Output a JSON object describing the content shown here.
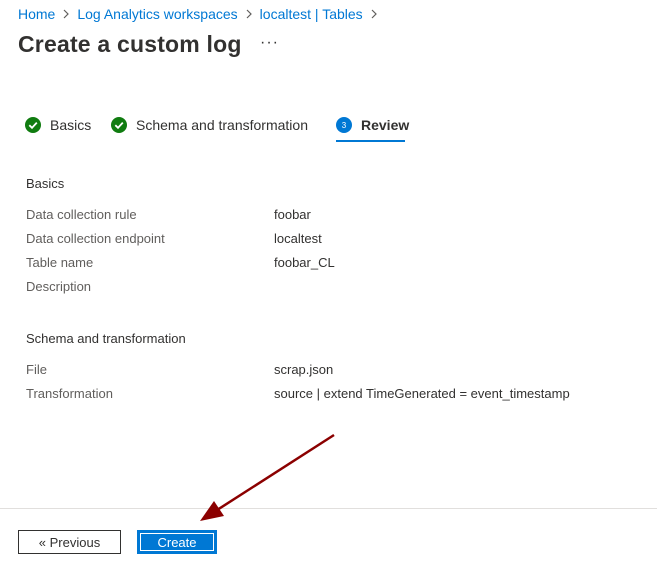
{
  "breadcrumb": {
    "items": [
      "Home",
      "Log Analytics workspaces",
      "localtest | Tables"
    ]
  },
  "page": {
    "title": "Create a custom log",
    "more_label": "···"
  },
  "steps": [
    {
      "label": "Basics",
      "status": "complete"
    },
    {
      "label": "Schema and transformation",
      "status": "complete"
    },
    {
      "label": "Review",
      "status": "active",
      "number": "3"
    }
  ],
  "review": {
    "basics": {
      "heading": "Basics",
      "rows": [
        {
          "label": "Data collection rule",
          "value": "foobar"
        },
        {
          "label": "Data collection endpoint",
          "value": "localtest"
        },
        {
          "label": "Table name",
          "value": "foobar_CL"
        },
        {
          "label": "Description",
          "value": ""
        }
      ]
    },
    "schema": {
      "heading": "Schema and transformation",
      "rows": [
        {
          "label": "File",
          "value": "scrap.json"
        },
        {
          "label": "Transformation",
          "value": "source | extend TimeGenerated = event_timestamp"
        }
      ]
    }
  },
  "footer": {
    "previous_label": "« Previous",
    "create_label": "Create"
  },
  "colors": {
    "accent": "#0078d4",
    "success": "#107c10",
    "annotation_arrow": "#8b0000"
  }
}
